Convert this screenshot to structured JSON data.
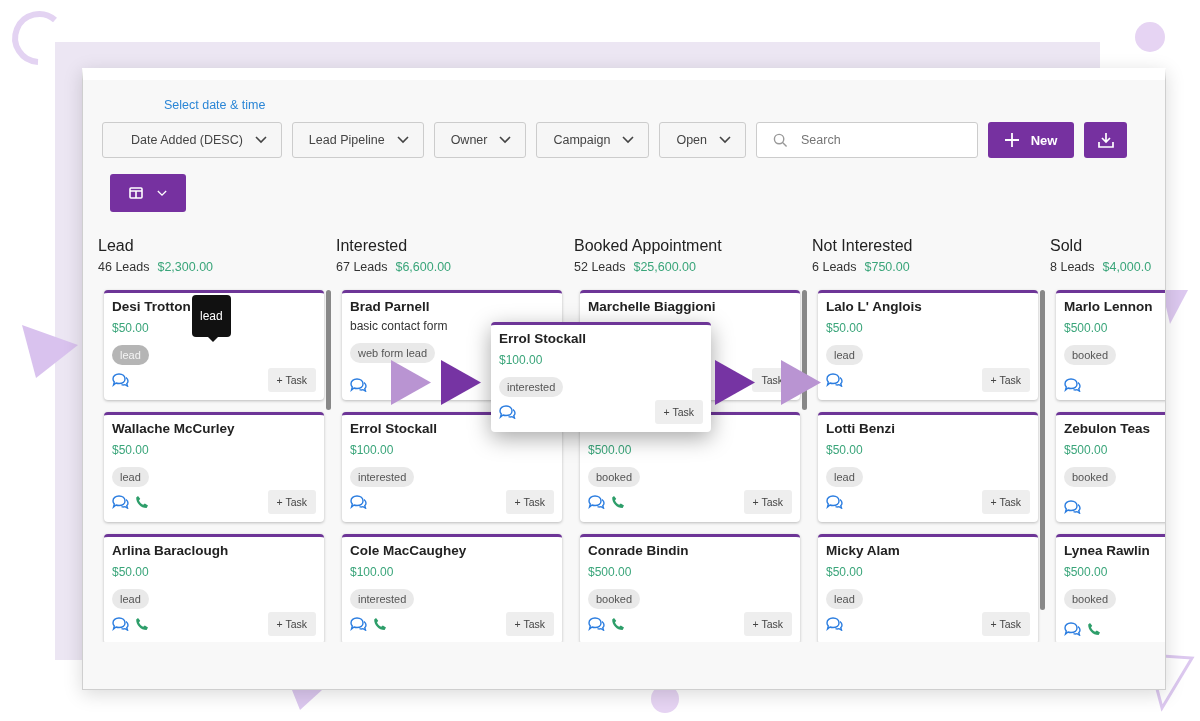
{
  "toolbar": {
    "date_link": "Select date & time",
    "dropdowns": [
      "Date Added (DESC)",
      "Lead Pipeline",
      "Owner",
      "Campaign",
      "Open"
    ],
    "search": {
      "placeholder": "Search"
    },
    "new_button": "New"
  },
  "columns": [
    {
      "title": "Lead",
      "count": "46 Leads",
      "total": "$2,300.00",
      "scrollbar": true,
      "cards": [
        {
          "name": "Desi Trotton",
          "amount": "$50.00",
          "tag": "lead",
          "tag_hovered": true,
          "tooltip": "lead",
          "chat": true,
          "phone": false,
          "task": "+ Task"
        },
        {
          "name": "Wallache McCurley",
          "amount": "$50.00",
          "tag": "lead",
          "tag_hovered": false,
          "chat": true,
          "phone": true,
          "task": "+ Task"
        },
        {
          "name": "Arlina Baraclough",
          "amount": "$50.00",
          "tag": "lead",
          "tag_hovered": false,
          "chat": true,
          "phone": true,
          "task": "+ Task"
        }
      ]
    },
    {
      "title": "Interested",
      "count": "67 Leads",
      "total": "$6,600.00",
      "scrollbar": false,
      "cards": [
        {
          "name": "Brad Parnell",
          "subtitle": "basic contact form",
          "tag": "web form lead",
          "tag_hovered": false,
          "chat": true,
          "phone": false
        },
        {
          "name": "Errol Stockall",
          "amount": "$100.00",
          "tag": "interested",
          "tag_hovered": false,
          "chat": true,
          "phone": false,
          "task": "+ Task"
        },
        {
          "name": "Cole MacCaughey",
          "amount": "$100.00",
          "tag": "interested",
          "tag_hovered": false,
          "chat": true,
          "phone": true,
          "task": "+ Task"
        }
      ]
    },
    {
      "title": "Booked Appointment",
      "count": "52 Leads",
      "total": "$25,600.00",
      "scrollbar": true,
      "cards": [
        {
          "name": "Marchelle Biaggioni",
          "task": "Task"
        },
        {
          "amount": "$500.00",
          "tag": "booked",
          "tag_hovered": false,
          "chat": true,
          "phone": true,
          "task": "+ Task"
        },
        {
          "name": "Conrade Bindin",
          "amount": "$500.00",
          "tag": "booked",
          "tag_hovered": false,
          "chat": true,
          "phone": true,
          "task": "+ Task"
        }
      ]
    },
    {
      "title": "Not Interested",
      "count": "6 Leads",
      "total": "$750.00",
      "scrollbar": true,
      "cards": [
        {
          "name": "Lalo L' Anglois",
          "amount": "$50.00",
          "tag": "lead",
          "tag_hovered": false,
          "chat": true,
          "phone": false,
          "task": "+ Task"
        },
        {
          "name": "Lotti Benzi",
          "amount": "$50.00",
          "tag": "lead",
          "tag_hovered": false,
          "chat": true,
          "phone": false,
          "task": "+ Task"
        },
        {
          "name": "Micky Alam",
          "amount": "$50.00",
          "tag": "lead",
          "tag_hovered": false,
          "chat": true,
          "phone": false,
          "task": "+ Task"
        }
      ]
    },
    {
      "title": "Sold",
      "count": "8 Leads",
      "total": "$4,000.0",
      "scrollbar": false,
      "cards": [
        {
          "name": "Marlo Lennon",
          "amount": "$500.00",
          "tag": "booked",
          "tag_hovered": false,
          "chat": true,
          "phone": false
        },
        {
          "name": "Zebulon Teas",
          "amount": "$500.00",
          "tag": "booked",
          "tag_hovered": false,
          "chat": true,
          "phone": false
        },
        {
          "name": "Lynea Rawlin",
          "amount": "$500.00",
          "tag": "booked",
          "tag_hovered": false,
          "chat": true,
          "phone": true
        }
      ]
    }
  ],
  "dragged_card": {
    "name": "Errol Stockall",
    "amount": "$100.00",
    "tag": "interested",
    "tag_hovered": false,
    "chat": true,
    "task": "+ Task"
  }
}
